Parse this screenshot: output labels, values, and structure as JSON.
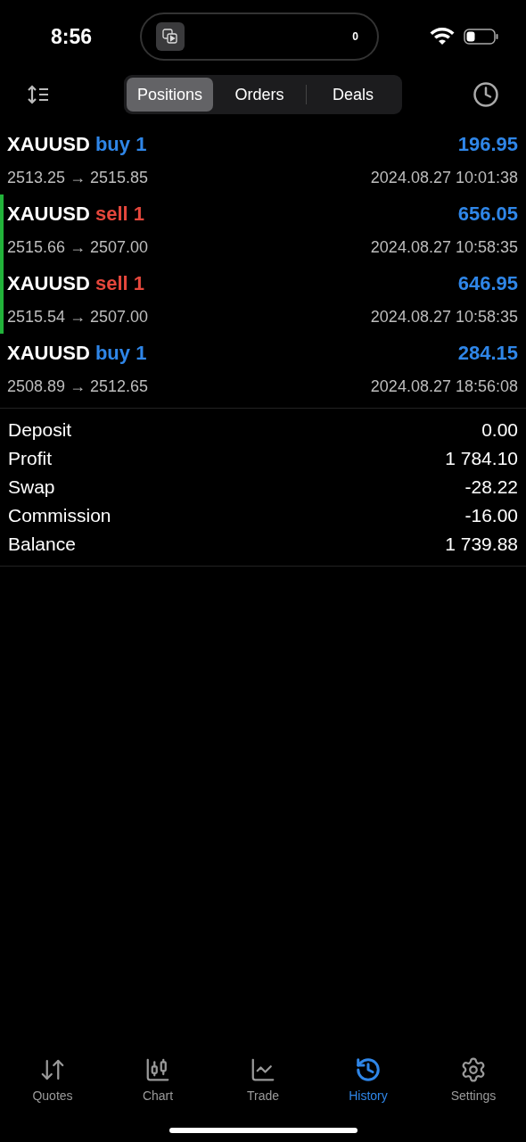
{
  "status_bar": {
    "time": "8:56",
    "island_count": "0"
  },
  "segments": [
    {
      "label": "Positions",
      "selected": true
    },
    {
      "label": "Orders",
      "selected": false
    },
    {
      "label": "Deals",
      "selected": false
    }
  ],
  "deals": [
    {
      "symbol": "XAUUSD",
      "kind": "buy",
      "side": "buy 1",
      "profit": "196.95",
      "prices": "2513.25 → 2515.85",
      "time": "2024.08.27 10:01:38",
      "highlighted": false
    },
    {
      "symbol": "XAUUSD",
      "kind": "sell",
      "side": "sell 1",
      "profit": "656.05",
      "prices": "2515.66 → 2507.00",
      "time": "2024.08.27 10:58:35",
      "highlighted": true
    },
    {
      "symbol": "XAUUSD",
      "kind": "sell",
      "side": "sell 1",
      "profit": "646.95",
      "prices": "2515.54 → 2507.00",
      "time": "2024.08.27 10:58:35",
      "highlighted": true
    },
    {
      "symbol": "XAUUSD",
      "kind": "buy",
      "side": "buy 1",
      "profit": "284.15",
      "prices": "2508.89 → 2512.65",
      "time": "2024.08.27 18:56:08",
      "highlighted": false
    }
  ],
  "summary": [
    {
      "label": "Deposit",
      "value": "0.00"
    },
    {
      "label": "Profit",
      "value": "1 784.10"
    },
    {
      "label": "Swap",
      "value": "-28.22"
    },
    {
      "label": "Commission",
      "value": "-16.00"
    },
    {
      "label": "Balance",
      "value": "1 739.88"
    }
  ],
  "tab_bar": [
    {
      "kind": "quotes",
      "label": "Quotes",
      "selected": false
    },
    {
      "kind": "chart",
      "label": "Chart",
      "selected": false
    },
    {
      "kind": "trade",
      "label": "Trade",
      "selected": false
    },
    {
      "kind": "history",
      "label": "History",
      "selected": true
    },
    {
      "kind": "settings",
      "label": "Settings",
      "selected": false
    }
  ]
}
